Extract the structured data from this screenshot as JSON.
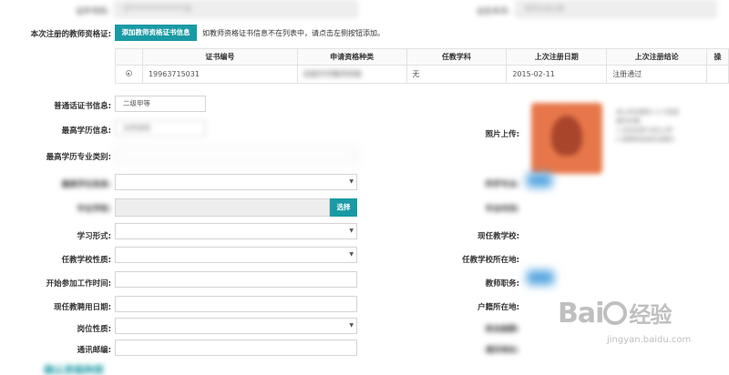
{
  "top_row": {
    "id_label": "证件号码:",
    "id_value": "37***************35",
    "birth_label": "出生年月:",
    "birth_value": "1972-03-28"
  },
  "cert_section": {
    "label": "本次注册的教师资格证:",
    "add_button": "添加教师资格证书信息",
    "hint": "如教师资格证书信息不在列表中，请点击左侧按钮添加。",
    "columns": [
      "",
      "证书编号",
      "申请资格种类",
      "任教学科",
      "上次注册日期",
      "上次注册结论",
      "操"
    ],
    "rows": [
      {
        "cert_no": "19963715031",
        "kind": "初级中学教师资格",
        "subject": "无",
        "last_date": "2015-02-11",
        "conclusion": "注册通过"
      }
    ]
  },
  "form_left": {
    "mandarin_label": "普通话证书信息:",
    "mandarin_value": "二级甲等",
    "edu_label": "最高学历信息:",
    "edu_value": "大学本科",
    "major_label": "最高学历专业类别:",
    "degree_label": "最高学位信息:",
    "school_label": "毕业学校:",
    "select_button": "选择",
    "study_form_label": "学习形式:",
    "school_nature_label": "任教学校性质:",
    "work_start_label": "开始参加工作时间:",
    "hire_date_label": "现任教聘用日期:",
    "post_nature_label": "岗位性质:",
    "postal_label": "通讯邮编:",
    "confirm_title": "确认资格种类"
  },
  "form_right": {
    "photo_label": "照片上传:",
    "photo_hint_1": "请上传近期本人1寸免冠",
    "photo_hint_2": "操作步骤:",
    "photo_hint_3": "1.点击左侧\"点击上传\"",
    "photo_hint_4": "2.如需修改请点击图片",
    "degree_major_label": "所学专业:",
    "grad_time_label": "毕业时间:",
    "current_school_label": "现任教学校:",
    "school_region_label": "任教学校所在地:",
    "teacher_post_label": "教师职务:",
    "household_label": "户籍所在地:",
    "political_label": "政治面貌:",
    "address_label": "通讯地址:"
  },
  "watermark": {
    "brand": "Bai",
    "brand_tail": "经验",
    "url": "jingyan.baidu.com"
  },
  "colors": {
    "accent": "#1a9aa5",
    "photo_bg": "#e7774a"
  }
}
